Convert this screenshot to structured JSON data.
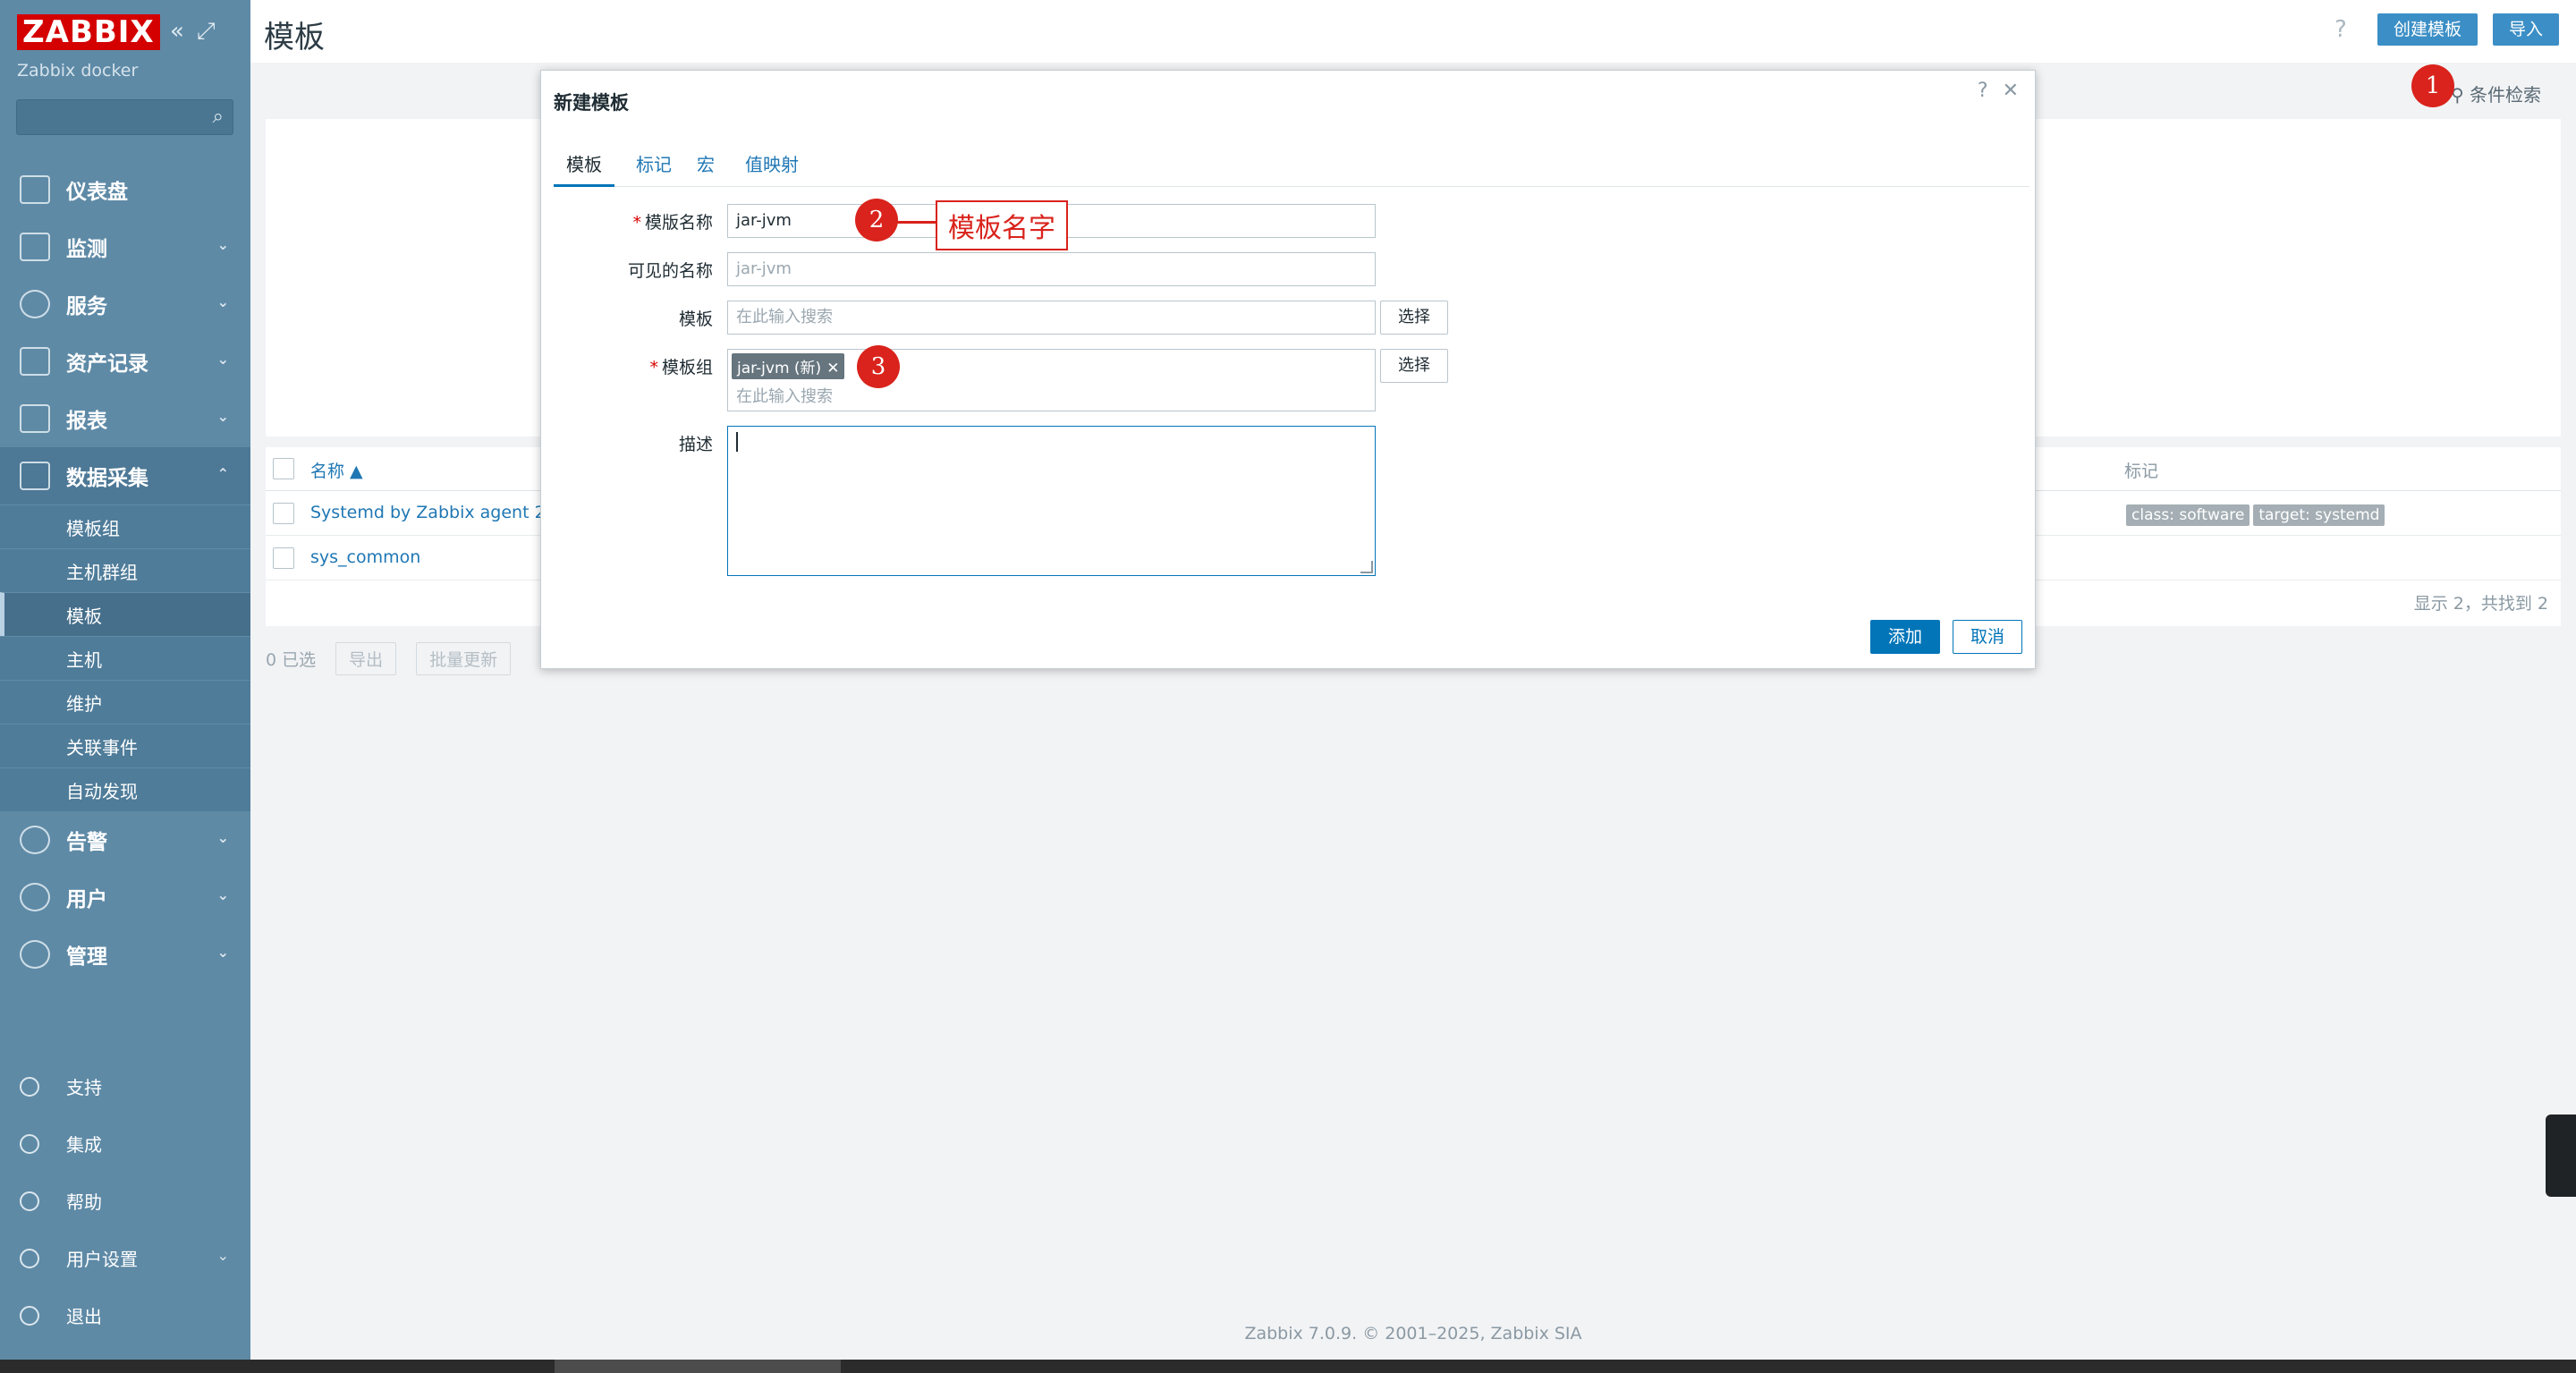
{
  "sidebar": {
    "logo": "ZABBIX",
    "instance": "Zabbix docker",
    "main_nav": [
      {
        "label": "仪表盘",
        "icon": "dashboard-icon"
      },
      {
        "label": "监测",
        "icon": "monitoring-icon"
      },
      {
        "label": "服务",
        "icon": "services-icon"
      },
      {
        "label": "资产记录",
        "icon": "inventory-icon"
      },
      {
        "label": "报表",
        "icon": "reports-icon"
      },
      {
        "label": "数据采集",
        "icon": "data-collection-icon"
      }
    ],
    "sub_nav": [
      "模板组",
      "主机群组",
      "模板",
      "主机",
      "维护",
      "关联事件",
      "自动发现"
    ],
    "main_nav2": [
      {
        "label": "告警",
        "icon": "bell-icon"
      },
      {
        "label": "用户",
        "icon": "users-icon"
      },
      {
        "label": "管理",
        "icon": "gear-icon"
      }
    ],
    "bottom_nav": [
      {
        "label": "支持",
        "icon": "headset-icon"
      },
      {
        "label": "集成",
        "icon": "integrations-icon"
      },
      {
        "label": "帮助",
        "icon": "help-icon"
      },
      {
        "label": "用户设置",
        "icon": "user-settings-icon"
      },
      {
        "label": "退出",
        "icon": "power-icon"
      }
    ]
  },
  "header": {
    "title": "模板",
    "help": "?",
    "create_button": "创建模板",
    "import_button": "导入"
  },
  "filter": {
    "label": "条件检索"
  },
  "table": {
    "col_name": "名称 ▲",
    "col_tags": "标记",
    "rows": [
      {
        "name": "Systemd by Zabbix agent 2",
        "tags": [
          "class: software",
          "target: systemd"
        ]
      },
      {
        "name": "sys_common",
        "tags": []
      }
    ],
    "count_text": "显示 2，共找到 2",
    "selected": "0 已选",
    "bulk_export": "导出",
    "bulk_update": "批量更新"
  },
  "modal": {
    "title": "新建模板",
    "tabs": [
      "模板",
      "标记",
      "宏",
      "值映射"
    ],
    "fields": {
      "template_name_label": "模版名称",
      "template_name_value": "jar-jvm",
      "visible_name_label": "可见的名称",
      "visible_name_placeholder": "jar-jvm",
      "templates_label": "模板",
      "templates_placeholder": "在此输入搜索",
      "groups_label": "模板组",
      "group_chip": "jar-jvm (新)",
      "groups_placeholder": "在此输入搜索",
      "description_label": "描述",
      "select_button": "选择"
    },
    "add_button": "添加",
    "cancel_button": "取消"
  },
  "annotations": {
    "badge1": "1",
    "badge2": "2",
    "badge3": "3",
    "callout_text": "模板名字"
  },
  "footer": "Zabbix 7.0.9. © 2001–2025, Zabbix SIA",
  "colors": {
    "sidebar": "#5e8aa6",
    "primary": "#0275b8",
    "annotation": "#d9231c",
    "logo": "#d40000"
  }
}
